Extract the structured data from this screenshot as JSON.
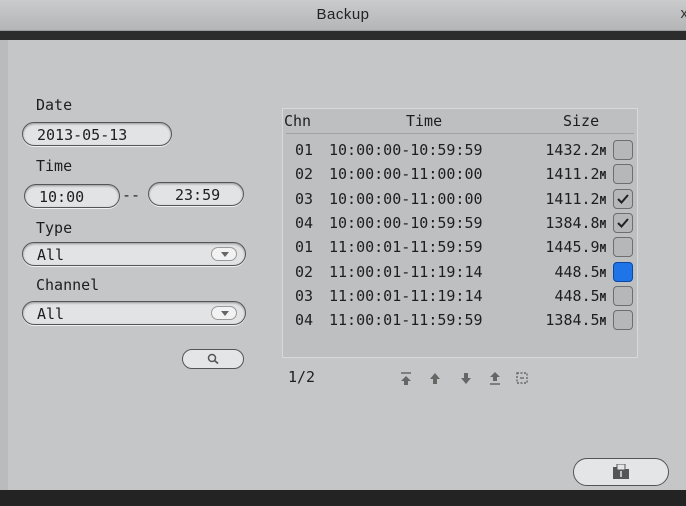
{
  "window": {
    "title": "Backup",
    "close": "x"
  },
  "search": {
    "date_label": "Date",
    "date_value": "2013-05-13",
    "time_label": "Time",
    "time_start": "10:00",
    "time_sep": "--",
    "time_end": "23:59",
    "type_label": "Type",
    "type_value": "All",
    "channel_label": "Channel",
    "channel_value": "All",
    "search_icon": "magnifier-icon"
  },
  "results": {
    "headers": {
      "chn": "Chn",
      "time": "Time",
      "size": "Size"
    },
    "rows": [
      {
        "chn": "01",
        "time": "10:00:00-10:59:59",
        "size": "1432.2",
        "unit": "M",
        "checked": false,
        "selected": false
      },
      {
        "chn": "02",
        "time": "10:00:00-11:00:00",
        "size": "1411.2",
        "unit": "M",
        "checked": false,
        "selected": false
      },
      {
        "chn": "03",
        "time": "10:00:00-11:00:00",
        "size": "1411.2",
        "unit": "M",
        "checked": true,
        "selected": false
      },
      {
        "chn": "04",
        "time": "10:00:00-10:59:59",
        "size": "1384.8",
        "unit": "M",
        "checked": true,
        "selected": false
      },
      {
        "chn": "01",
        "time": "11:00:01-11:59:59",
        "size": "1445.9",
        "unit": "M",
        "checked": false,
        "selected": false
      },
      {
        "chn": "02",
        "time": "11:00:01-11:19:14",
        "size": "448.5",
        "unit": "M",
        "checked": false,
        "selected": true
      },
      {
        "chn": "03",
        "time": "11:00:01-11:19:14",
        "size": "448.5",
        "unit": "M",
        "checked": false,
        "selected": false
      },
      {
        "chn": "04",
        "time": "11:00:01-11:59:59",
        "size": "1384.5",
        "unit": "M",
        "checked": false,
        "selected": false
      }
    ],
    "page": "1/2",
    "nav_icons": [
      "first-page-icon",
      "prev-page-icon",
      "next-page-icon",
      "last-page-icon",
      "select-all-icon"
    ]
  },
  "footer": {
    "backup_icon": "backup-folder-icon"
  },
  "colors": {
    "selected": "#1f74e8",
    "panel": "#c4c6c8"
  }
}
